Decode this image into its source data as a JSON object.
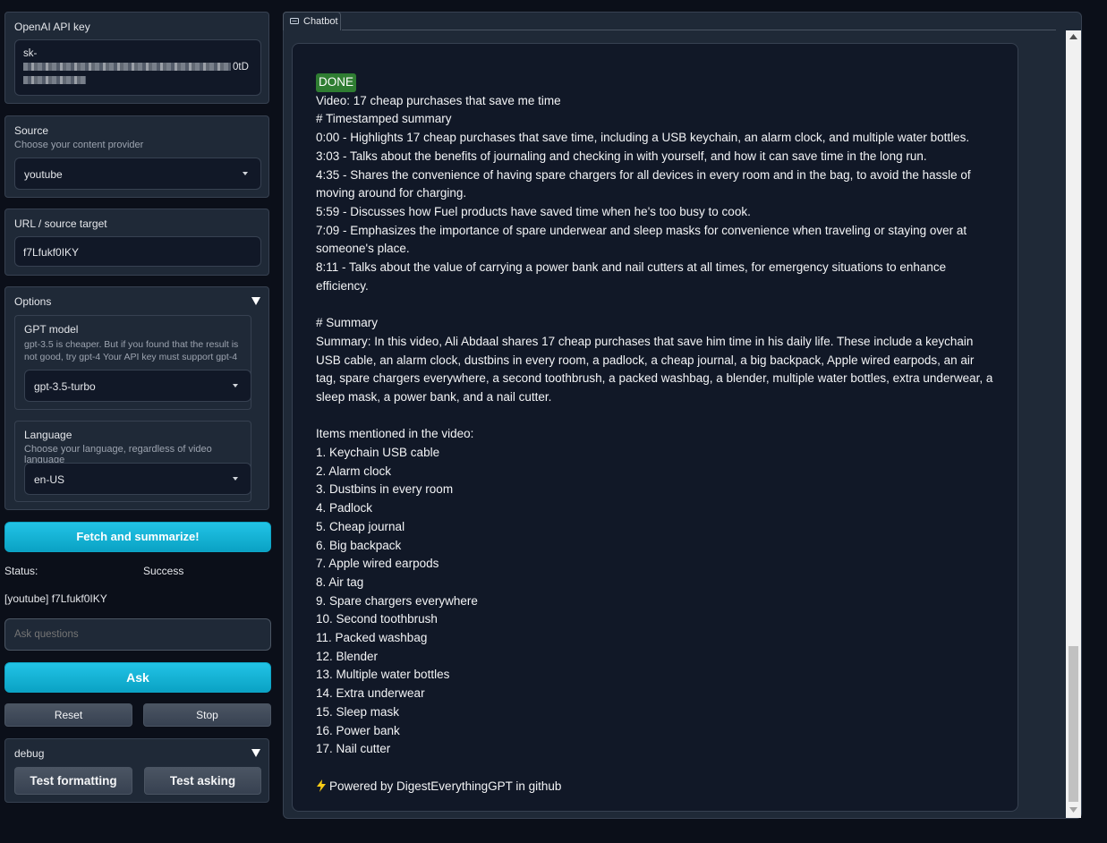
{
  "sidebar": {
    "api_key": {
      "label": "OpenAI API key",
      "value_prefix": "sk-",
      "value_suffix": "0tD"
    },
    "source": {
      "label": "Source",
      "description": "Choose your content provider",
      "selected": "youtube"
    },
    "url": {
      "label": "URL / source target",
      "value": "f7Lfukf0IKY"
    },
    "options": {
      "label": "Options",
      "gpt_model": {
        "label": "GPT model",
        "description": "gpt-3.5 is cheaper. But if you found that the result is not good, try gpt-4 Your API key must support gpt-4",
        "selected": "gpt-3.5-turbo"
      },
      "language": {
        "label": "Language",
        "description": "Choose your language, regardless of video language",
        "selected": "en-US"
      }
    },
    "fetch_button": "Fetch and summarize!",
    "status": {
      "label": "Status:",
      "value": "Success"
    },
    "source_info": "[youtube] f7Lfukf0IKY",
    "ask_placeholder": "Ask questions",
    "ask_button": "Ask",
    "reset_button": "Reset",
    "stop_button": "Stop",
    "debug": {
      "label": "debug",
      "test_formatting": "Test formatting",
      "test_asking": "Test asking"
    }
  },
  "chatbot": {
    "tab_label": "Chatbot",
    "tab_icon": "chat-icon",
    "message": {
      "badge": "DONE",
      "video": "Video: 17 cheap purchases that save me time",
      "timestamp_heading": "# Timestamped summary",
      "timestamps": [
        "0:00 - Highlights 17 cheap purchases that save time, including a USB keychain, an alarm clock, and multiple water bottles.",
        "3:03 - Talks about the benefits of journaling and checking in with yourself, and how it can save time in the long run.",
        "4:35 - Shares the convenience of having spare chargers for all devices in every room and in the bag, to avoid the hassle of moving around for charging.",
        "5:59 - Discusses how Fuel products have saved time when he's too busy to cook.",
        "7:09 - Emphasizes the importance of spare underwear and sleep masks for convenience when traveling or staying over at someone's place.",
        "8:11 - Talks about the value of carrying a power bank and nail cutters at all times, for emergency situations to enhance efficiency."
      ],
      "summary_heading": "# Summary",
      "summary": "Summary: In this video, Ali Abdaal shares 17 cheap purchases that save him time in his daily life. These include a keychain USB cable, an alarm clock, dustbins in every room, a padlock, a cheap journal, a big backpack, Apple wired earpods, an air tag, spare chargers everywhere, a second toothbrush, a packed washbag, a blender, multiple water bottles, extra underwear, a sleep mask, a power bank, and a nail cutter.",
      "items_heading": "Items mentioned in the video:",
      "items": [
        "1. Keychain USB cable",
        "2. Alarm clock",
        "3. Dustbins in every room",
        "4. Padlock",
        "5. Cheap journal",
        "6. Big backpack",
        "7. Apple wired earpods",
        "8. Air tag",
        "9. Spare chargers everywhere",
        "10. Second toothbrush",
        "11. Packed washbag",
        "12. Blender",
        "13. Multiple water bottles",
        "14. Extra underwear",
        "15. Sleep mask",
        "16. Power bank",
        "17. Nail cutter"
      ],
      "footer_icon": "lightning-icon",
      "footer": "Powered by DigestEverythingGPT in github"
    }
  },
  "colors": {
    "background": "#0b0f19",
    "panel": "#1f2937",
    "input": "#111827",
    "accent": "#0ea5c6",
    "done_badge": "#2f7d32",
    "lightning": "#facc15"
  }
}
